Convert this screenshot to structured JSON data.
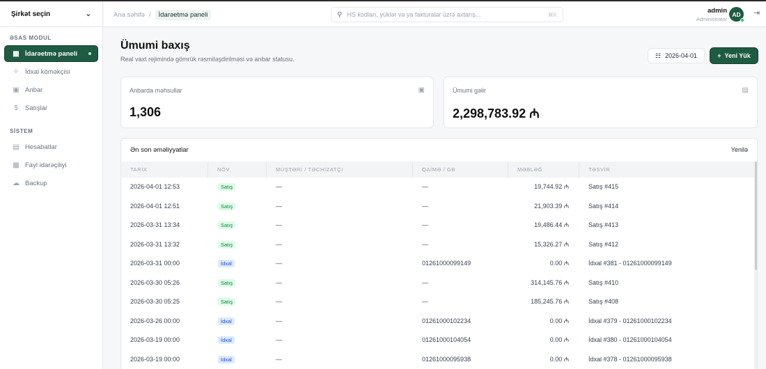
{
  "sidebar": {
    "company_label": "Şirkət seçin",
    "sections": [
      {
        "title": "ƏSAS MODUL",
        "items": [
          {
            "label": "İdarəetmə paneli",
            "icon": "grid-icon",
            "active": true
          },
          {
            "label": "İdxal köməkçisi",
            "icon": "sparkle-icon",
            "active": false
          },
          {
            "label": "Anbar",
            "icon": "archive-icon",
            "active": false
          },
          {
            "label": "Satışlar",
            "icon": "dollar-icon",
            "active": false
          }
        ]
      },
      {
        "title": "SİSTEM",
        "items": [
          {
            "label": "Hesabatlar",
            "icon": "document-icon",
            "active": false
          },
          {
            "label": "Fayl idarəçiliyi",
            "icon": "folder-icon",
            "active": false
          },
          {
            "label": "Backup",
            "icon": "cloud-icon",
            "active": false
          }
        ]
      }
    ]
  },
  "header": {
    "breadcrumb": {
      "home": "Ana səhifə",
      "separator": "/",
      "current": "İdarəetmə paneli"
    },
    "search": {
      "placeholder": "HS kodları, yüklər və ya fakturalar üzrə axtarış...",
      "shortcut": "⌘K"
    },
    "user": {
      "name": "admin",
      "role": "Administrator",
      "initials": "AD"
    }
  },
  "main": {
    "title": "Ümumi baxış",
    "subtitle": "Real vaxt rejimində gömrük rəsmiləşdirilməsi və anbar statusu.",
    "date": "2026-04-01",
    "new_load_label": "Yeni Yük"
  },
  "stats": {
    "warehouse": {
      "label": "Anbarda məhsullar",
      "value": "1,306"
    },
    "income": {
      "label": "Ümumi gəlir",
      "value": "2,298,783.92 ₼"
    }
  },
  "table": {
    "title": "Ən son əməliyyatlar",
    "refresh_label": "Yenilə",
    "columns": [
      "TARİX",
      "NÖV",
      "MÜŞTƏRİ / TƏCHİZATÇI",
      "QAİMƏ / GB",
      "MƏBLƏĞ",
      "TƏSVİR"
    ],
    "rows": [
      {
        "date": "2026-04-01 12:53",
        "type": "Satış",
        "kind": "sale",
        "party": "—",
        "invoice": "—",
        "amount": "19,744.92 ₼",
        "desc": "Satış #415"
      },
      {
        "date": "2026-04-01 12:51",
        "type": "Satış",
        "kind": "sale",
        "party": "—",
        "invoice": "—",
        "amount": "21,903.39 ₼",
        "desc": "Satış #414"
      },
      {
        "date": "2026-03-31 13:34",
        "type": "Satış",
        "kind": "sale",
        "party": "—",
        "invoice": "—",
        "amount": "19,486.44 ₼",
        "desc": "Satış #413"
      },
      {
        "date": "2026-03-31 13:32",
        "type": "Satış",
        "kind": "sale",
        "party": "—",
        "invoice": "—",
        "amount": "15,326.27 ₼",
        "desc": "Satış #412"
      },
      {
        "date": "2026-03-31 00:00",
        "type": "İdxal",
        "kind": "import",
        "party": "—",
        "invoice": "01261000099149",
        "amount": "0.00 ₼",
        "desc": "İdxal #381 - 01261000099149"
      },
      {
        "date": "2026-03-30 05:26",
        "type": "Satış",
        "kind": "sale",
        "party": "—",
        "invoice": "—",
        "amount": "314,145.76 ₼",
        "desc": "Satış #410"
      },
      {
        "date": "2026-03-30 05:25",
        "type": "Satış",
        "kind": "sale",
        "party": "—",
        "invoice": "—",
        "amount": "185,245.76 ₼",
        "desc": "Satış #408"
      },
      {
        "date": "2026-03-26 00:00",
        "type": "İdxal",
        "kind": "import",
        "party": "—",
        "invoice": "01261000102234",
        "amount": "0.00 ₼",
        "desc": "İdxal #379 - 01261000102234"
      },
      {
        "date": "2026-03-19 00:00",
        "type": "İdxal",
        "kind": "import",
        "party": "—",
        "invoice": "01261000104054",
        "amount": "0.00 ₼",
        "desc": "İdxal #380 - 01261000104054"
      },
      {
        "date": "2026-03-19 00:00",
        "type": "İdxal",
        "kind": "import",
        "party": "—",
        "invoice": "01261000095938",
        "amount": "0.00 ₼",
        "desc": "İdxal #378 - 01261000095938"
      }
    ]
  },
  "colors": {
    "accent": "#1f5b43",
    "sale_badge": "#dcfce7",
    "import_badge": "#dbeafe"
  }
}
